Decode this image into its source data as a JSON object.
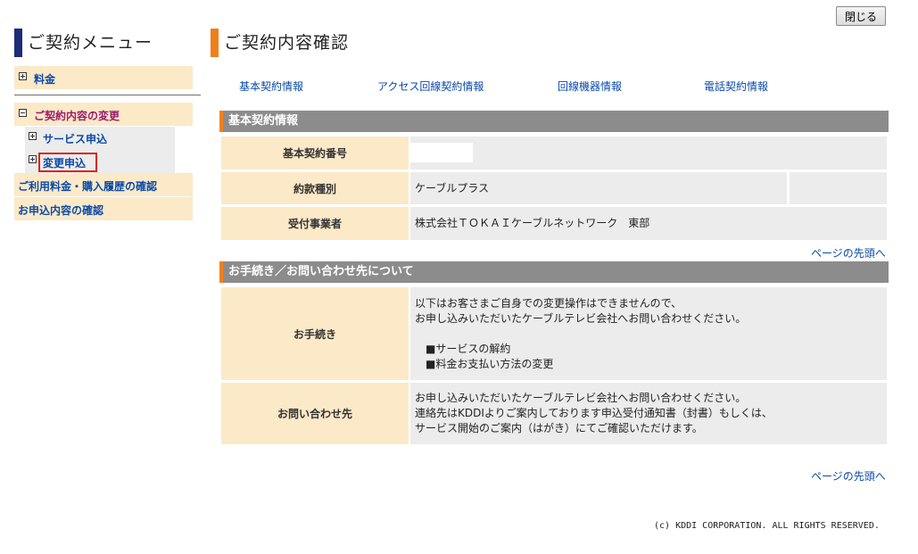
{
  "header": {
    "close_label": "閉じる"
  },
  "sidebar": {
    "title": "ご契約メニュー",
    "items": [
      {
        "label": "料金",
        "icon": "plus-box-icon"
      },
      {
        "label": "ご契約内容の変更",
        "icon": "minus-box-icon"
      },
      {
        "label": "サービス申込",
        "icon": "plus-box-icon"
      },
      {
        "label": "変更申込",
        "icon": "plus-box-icon"
      },
      {
        "label": "ご利用料金・購入履歴の確認"
      },
      {
        "label": "お申込内容の確認"
      }
    ]
  },
  "main": {
    "title": "ご契約内容確認",
    "tabs": [
      {
        "label": "基本契約情報"
      },
      {
        "label": "アクセス回線契約情報"
      },
      {
        "label": "回線機器情報"
      },
      {
        "label": "電話契約情報"
      }
    ],
    "basic_section": {
      "heading": "基本契約情報",
      "rows": [
        {
          "label": "基本契約番号",
          "value": ""
        },
        {
          "label": "約款種別",
          "value": "ケーブルプラス"
        },
        {
          "label": "受付事業者",
          "value": "株式会社ＴＯＫＡＩケーブルネットワーク　東部"
        }
      ]
    },
    "back_to_top": "ページの先頭へ",
    "contact_section": {
      "heading": "お手続き／お問い合わせ先について",
      "rows": [
        {
          "label": "お手続き",
          "text": "以下はお客さまご自身での変更操作はできませんので、\nお申し込みいただいたケーブルテレビ会社へお問い合わせください。",
          "bullets": [
            "■サービスの解約",
            "■料金お支払い方法の変更"
          ]
        },
        {
          "label": "お問い合わせ先",
          "text": "お申し込みいただいたケーブルテレビ会社へお問い合わせください。\n連絡先はKDDIよりご案内しております申込受付通知書（封書）もしくは、\nサービス開始のご案内（はがき）にてご確認いただけます。"
        }
      ]
    },
    "back_to_top_2": "ページの先頭へ"
  },
  "footer": {
    "copyright": "(c) KDDI CORPORATION. ALL RIGHTS RESERVED."
  },
  "colors": {
    "sidebar_accent": "#1e2b78",
    "title_accent": "#f07f1c",
    "label_bg": "#fbe9c8",
    "value_bg": "#ececec",
    "section_bar": "#8c8c8c",
    "link": "#0b4aa8",
    "active_link": "#9b1b6b",
    "highlight_border": "#e0231d"
  }
}
